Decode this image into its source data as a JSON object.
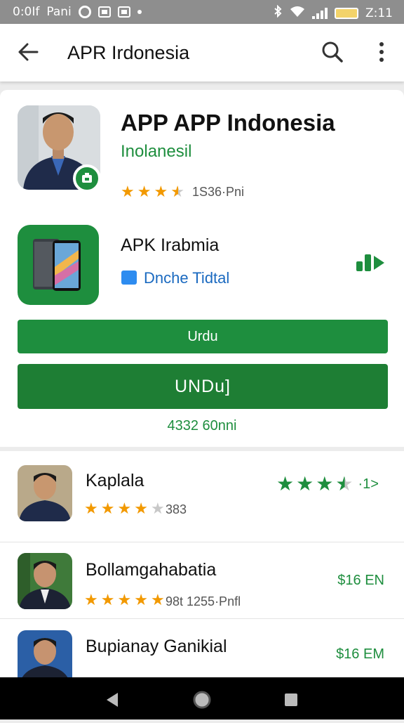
{
  "status_bar": {
    "time": "0:0If",
    "carrier": "Pani",
    "clock_right": "Z:11"
  },
  "app_bar": {
    "title": "APR Irdonesia",
    "back_icon": "arrow-back-icon",
    "search_icon": "search-icon",
    "more_icon": "more-vert-icon"
  },
  "header_app": {
    "title": "APP APP  Indonesia",
    "subtitle": "Inolanesil",
    "rating_stars": 3.5,
    "rating_text": "1S36·Pni"
  },
  "apk_app": {
    "title": "APK Irabmia",
    "developer": "Dnche Tidtal",
    "trend_icon": "bar-chart-icon"
  },
  "buttons": {
    "secondary_label": "Urdu",
    "primary_label": "UNDu]",
    "downloads": "4332 60nni"
  },
  "list": [
    {
      "title": "Kaplala",
      "stars": 4,
      "meta": "383",
      "right_stars": 3.5,
      "right_text": "·1>"
    },
    {
      "title": "Bollamgahabatia",
      "stars": 5,
      "meta": "98t 1255·Pnfl",
      "price": "$16 EN"
    },
    {
      "title": "Bupianay Ganikial",
      "stars": 0,
      "meta": "",
      "price": "$16 EM"
    }
  ],
  "colors": {
    "accent": "#1e8e3e",
    "star": "#f29900",
    "link": "#1b6ac0"
  }
}
